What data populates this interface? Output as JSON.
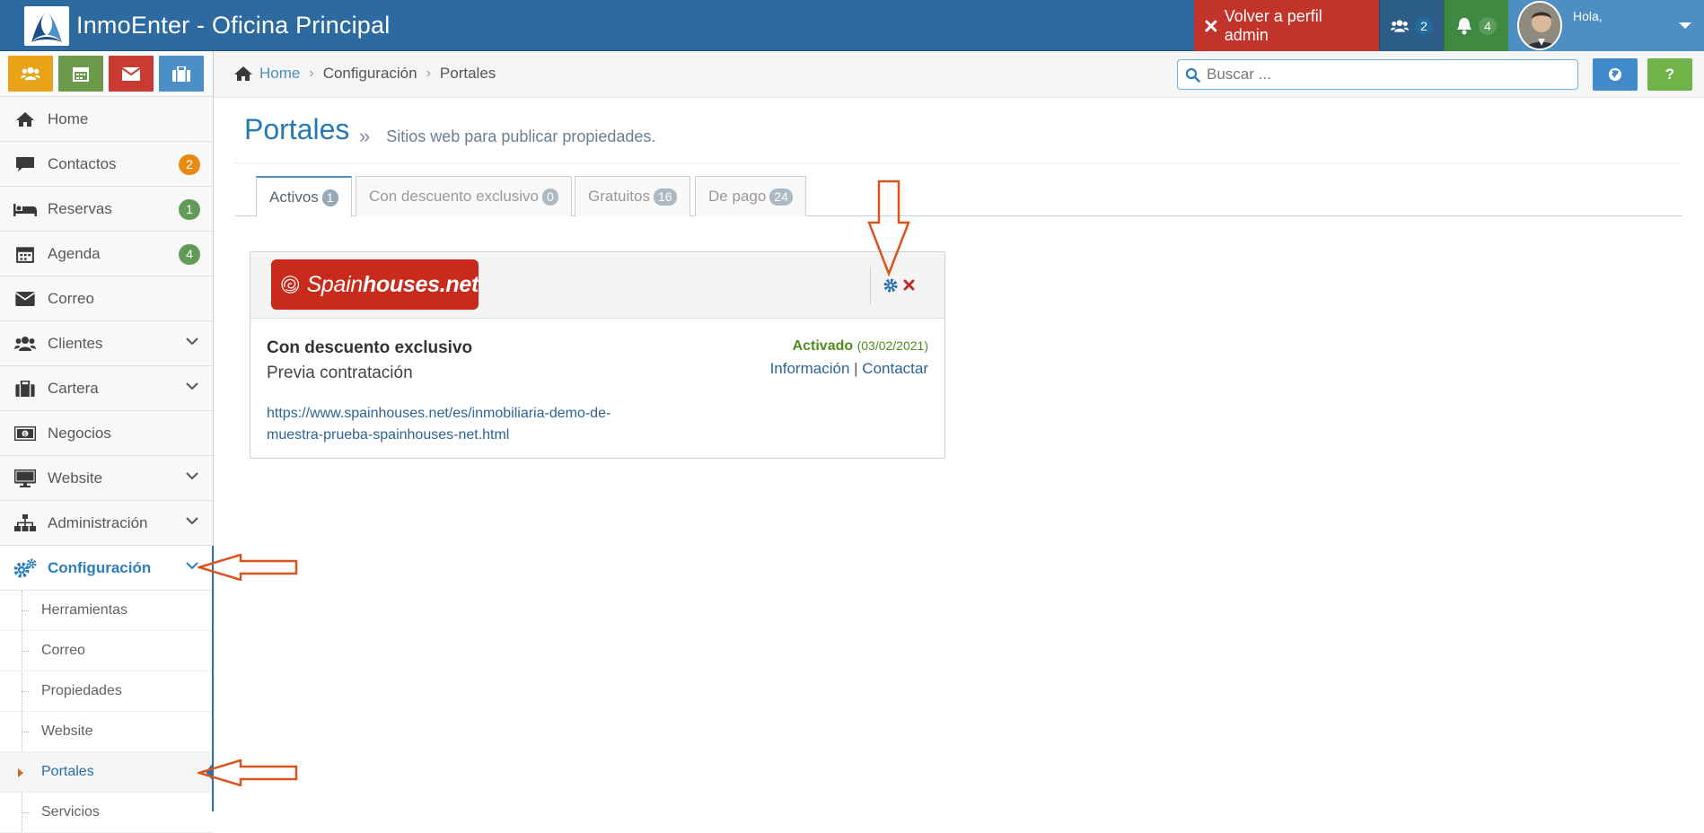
{
  "app": {
    "title": "InmoEnter - Oficina Principal",
    "admin_button": "Volver a perfil admin",
    "users_count": "2",
    "notifications_count": "4",
    "greeting": "Hola,"
  },
  "breadcrumb": {
    "home": "Home",
    "level1": "Configuración",
    "level2": "Portales"
  },
  "search": {
    "placeholder": "Buscar ..."
  },
  "help_label": "?",
  "sidebar": {
    "items": [
      {
        "label": "Home"
      },
      {
        "label": "Contactos",
        "badge": "2"
      },
      {
        "label": "Reservas",
        "badge": "1"
      },
      {
        "label": "Agenda",
        "badge": "4"
      },
      {
        "label": "Correo"
      },
      {
        "label": "Clientes"
      },
      {
        "label": "Cartera"
      },
      {
        "label": "Negocios"
      },
      {
        "label": "Website"
      },
      {
        "label": "Administración"
      },
      {
        "label": "Configuración"
      }
    ],
    "submenu": [
      {
        "label": "Herramientas"
      },
      {
        "label": "Correo"
      },
      {
        "label": "Propiedades"
      },
      {
        "label": "Website"
      },
      {
        "label": "Portales"
      },
      {
        "label": "Servicios"
      }
    ]
  },
  "page": {
    "title": "Portales",
    "separator": "»",
    "subtitle": "Sitios web para publicar propiedades."
  },
  "tabs": [
    {
      "label": "Activos",
      "count": "1"
    },
    {
      "label": "Con descuento exclusivo",
      "count": "0"
    },
    {
      "label": "Gratuitos",
      "count": "16"
    },
    {
      "label": "De pago",
      "count": "24"
    }
  ],
  "portal": {
    "logo_light": "Spain",
    "logo_bold": "houses.net",
    "title": "Con descuento exclusivo",
    "subtitle": "Previa contratación",
    "url": "https://www.spainhouses.net/es/inmobiliaria-demo-de-muestra-prueba-spainhouses-net.html",
    "status": "Activado",
    "date": "(03/02/2021)",
    "link_info": "Información",
    "link_sep": "|",
    "link_contact": "Contactar"
  },
  "colors": {
    "navbar": "#2c6aa0",
    "admin_btn": "#c2332c",
    "accent_blue": "#2679b5",
    "portal_red": "#c82b1b",
    "annotation_arrow": "#d8561b"
  }
}
